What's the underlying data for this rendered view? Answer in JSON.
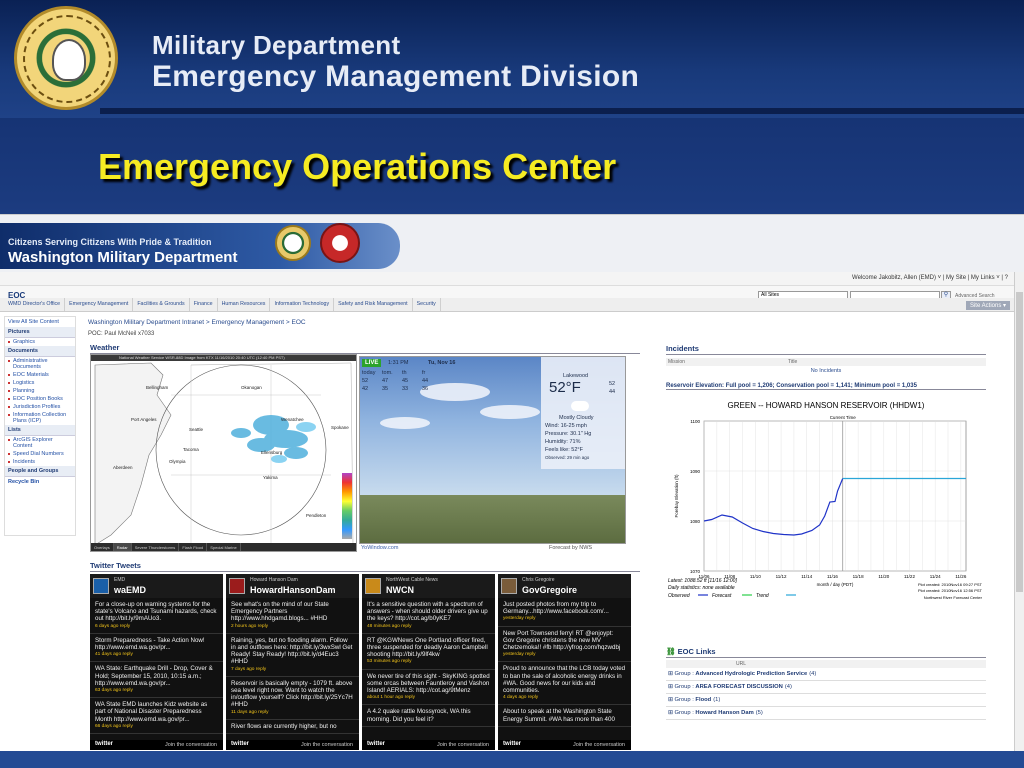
{
  "slide": {
    "header_line1": "Military Department",
    "header_line2": "Emergency Management Division",
    "title": "Emergency Operations Center",
    "title_color": "#f6ec22"
  },
  "site": {
    "tagline": "Citizens Serving Citizens With Pride & Tradition",
    "name": "Washington Military Department",
    "welcome": "Welcome Jakobitz, Allen (EMD) ˅ | My Site | My Links ˅ | ?",
    "title": "EOC",
    "search_scope": "All Sites",
    "advanced_search": "Advanced Search",
    "site_actions": "Site Actions ▾",
    "nav_tabs": [
      "WMD Director's Office",
      "Emergency Management",
      "Facilities & Grounds",
      "Finance",
      "Human Resources",
      "Information Technology",
      "Safety and Risk Management",
      "Security"
    ]
  },
  "leftnav": {
    "view_all": "View All Site Content",
    "sections": [
      {
        "head": "Pictures",
        "items": [
          "Graphics"
        ]
      },
      {
        "head": "Documents",
        "items": [
          "Administrative Documents",
          "EOC Materials",
          "Logistics",
          "Planning",
          "EOC Position Books",
          "Jurisdiction Profiles",
          "Information Collection Plans (ICP)"
        ]
      },
      {
        "head": "Lists",
        "items": [
          "ArcGIS Explorer Content",
          "Speed Dial Numbers",
          "Incidents"
        ]
      },
      {
        "head": "People and Groups",
        "items": []
      }
    ],
    "recycle": "Recycle Bin"
  },
  "main": {
    "breadcrumb": "Washington Military Department Intranet > Emergency Management > EOC",
    "poc": "POC: Paul McNeil x7033",
    "weather_title": "Weather",
    "map_header": "National Weather Service WSR-88D Image from  KTX 11/16/2010 20:40 UTC (12:40 PM PST)",
    "map_tabs": [
      "Overlays",
      "Radar",
      "Severe Thunderstorms",
      "Flash Flood",
      "Special Marine"
    ],
    "map_cities": [
      "Bellingham",
      "Port Angeles",
      "Seattle",
      "Tacoma",
      "Olympia",
      "Aberdeen",
      "Wenatchee",
      "Yakima",
      "Spokane",
      "Pendleton",
      "Ellensburg",
      "Okanogan"
    ],
    "yowindow": {
      "live": "LIVE",
      "time": "1:31 PM",
      "date": "Tu, Nov 16",
      "days": [
        "today",
        "tom.",
        "th",
        "fr"
      ],
      "highs": [
        "52",
        "47",
        "45",
        "44"
      ],
      "lows": [
        "42",
        "35",
        "33",
        "36"
      ],
      "location": "Lakewood",
      "temp": "52°F",
      "hi_lo": [
        "52",
        "44"
      ],
      "condition": "Mostly Cloudy",
      "wind": "Wind:  16-25 mph",
      "pressure": "Pressure:  30.1\" Hg",
      "humidity": "Humidity:  71%",
      "feels": "Feels like:  52°F",
      "observed": "Observed:    29 min ago",
      "footer_left": "YoWindow.com",
      "footer_right": "Forecast by NWS"
    },
    "tweets_title": "Twitter Tweets",
    "tweet_columns": [
      {
        "by": "EMD",
        "handle": "waEMD",
        "avatar_color": "#1a5fa8",
        "tweets": [
          {
            "text": "For a close-up on warning systems for the state's Volcano and Tsunami hazards, check out http://bit.ly/9mAUo3.",
            "ago": "6 days ago reply"
          },
          {
            "text": "Storm Preparedness - Take Action Now! http://www.emd.wa.gov/pr...",
            "ago": "41 days ago reply"
          },
          {
            "text": "WA State: Earthquake Drill - Drop, Cover & Hold; September 15, 2010, 10:15 a.m.; http://www.emd.wa.gov/pr...",
            "ago": "63 days ago reply"
          },
          {
            "text": "WA State EMD launches Kidz website as part of National Disaster Preparedness Month http://www.emd.wa.gov/pr...",
            "ago": "66 days ago reply"
          }
        ]
      },
      {
        "by": "Howard Hanson Dam",
        "handle": "HowardHansonDam",
        "avatar_color": "#9b1c1c",
        "tweets": [
          {
            "text": "See what's on the mind of our State Emergency Partners http://www.hhdgamd.blogs... #HHD",
            "ago": "2 hours ago reply"
          },
          {
            "text": "Raining, yes, but no flooding alarm. Follow in and outflows here: http://bit.ly/3wxSwl Get Ready! Stay Ready! http://bit.ly/d4Euc3 #HHD",
            "ago": "7 days ago reply"
          },
          {
            "text": "Reservoir is basically empty - 1079 ft. above sea level right now. Want to watch the in/outflow yourself? Click http://bit.ly/25Yc7H #HHD",
            "ago": "11 days ago reply"
          },
          {
            "text": "River flows are currently higher, but no",
            "ago": ""
          }
        ]
      },
      {
        "by": "NorthWest Cable News",
        "handle": "NWCN",
        "avatar_color": "#c98a1a",
        "tweets": [
          {
            "text": "It's a sensitive question with a spectrum of answers - when should older drivers give up the keys? http://cot.ag/b0yKE7",
            "ago": "48 minutes ago reply"
          },
          {
            "text": "RT @KGWNews One Portland officer fired, three suspended for deadly Aaron Campbell shooting http://bit.ly/9lf4kw",
            "ago": "53 minutes ago reply"
          },
          {
            "text": "We never tire of this sight - SkyKING spotted some orcas between Fauntleroy and Vashon Island! AERIALS: http://cot.ag/9tMenz",
            "ago": "about 1 hour ago reply"
          },
          {
            "text": "A 4.2 quake rattle Mossyrock, WA this morning. Did you feel it?",
            "ago": ""
          }
        ]
      },
      {
        "by": "Chris Gregoire",
        "handle": "GovGregoire",
        "avatar_color": "#7a5c3a",
        "tweets": [
          {
            "text": "Just posted photos from my trip to Germany...http://www.facebook.com/...",
            "ago": "yesterday reply"
          },
          {
            "text": "New Port Townsend ferry! RT @enjoypt: Gov Gregoire christens the new MV Chetzemoka!! #fb http://yfrog.com/hqzwdbj",
            "ago": "yesterday reply"
          },
          {
            "text": "Proud to announce that the LCB today voted to ban the sale of alcoholic energy drinks in #WA. Good news for our kids and communities.",
            "ago": "4 days ago reply"
          },
          {
            "text": "About to speak at the Washington State Energy Summit. #WA has more than 400",
            "ago": ""
          }
        ]
      }
    ],
    "twitter_label": "twitter",
    "join": "Join the conversation"
  },
  "incidents": {
    "title": "Incidents",
    "col_mission": "Mission",
    "col_title": "Title",
    "empty": "No Incidents"
  },
  "reservoir": {
    "title": "Reservoir Elevation: Full pool = 1,206; Conservation pool = 1,141; Minimum pool = 1,035",
    "note_latest": "Latest:  1088.52 ft [11/16 12:00]",
    "note_daily": "Daily statistics: none available",
    "legend": [
      "Observed",
      "Forecast",
      "Trend"
    ],
    "plot_created": "Plot created:  2010Nov16 09:27 PST",
    "plot_created2": "Plot created:  2010Nov16 12:56 PST",
    "center": "Northwest River Forecast Center"
  },
  "chart_data": {
    "type": "line",
    "title": "GREEN -- HOWARD HANSON RESERVOIR  (HHDW1)",
    "xlabel": "month / day (PDT)",
    "ylabel": "Forebay Elevation  (ft)",
    "annotation": "Current Time",
    "categories": [
      "11/06",
      "11/08",
      "11/10",
      "11/12",
      "11/14",
      "11/16",
      "11/18",
      "11/20",
      "11/22",
      "11/24",
      "11/26"
    ],
    "ylim": [
      1070,
      1100
    ],
    "yticks": [
      "1100",
      "1090",
      "1080",
      "1070"
    ],
    "current_time_x": 10.8,
    "series": [
      {
        "name": "Observed",
        "color": "#1f33c8",
        "points": [
          [
            0,
            1080
          ],
          [
            0.6,
            1080.3
          ],
          [
            1.4,
            1081.2
          ],
          [
            2.2,
            1080.8
          ],
          [
            3.0,
            1079.6
          ],
          [
            3.8,
            1078.5
          ],
          [
            4.6,
            1077.9
          ],
          [
            5.4,
            1077.5
          ],
          [
            6.2,
            1077.3
          ],
          [
            7.0,
            1077.2
          ],
          [
            7.6,
            1077.4
          ],
          [
            8.4,
            1078.1
          ],
          [
            9.0,
            1079.2
          ],
          [
            9.4,
            1081.0
          ],
          [
            9.8,
            1083.8
          ],
          [
            10.2,
            1083.9
          ],
          [
            10.4,
            1086.0
          ],
          [
            10.8,
            1088.5
          ]
        ]
      },
      {
        "name": "Forecast",
        "color": "#2aa6d8",
        "points": [
          [
            10.8,
            1088.5
          ],
          [
            11.0,
            1088.5
          ],
          [
            20.4,
            1088.5
          ]
        ]
      }
    ]
  },
  "eoc_links": {
    "title": "EOC Links",
    "col_url": "URL",
    "groups": [
      {
        "label": "Group : ",
        "name": "Advanced Hydrologic Prediction Service",
        "count": "(4)"
      },
      {
        "label": "Group : ",
        "name": "AREA FORECAST DISCUSSION",
        "count": "(4)"
      },
      {
        "label": "Group : ",
        "name": "Flood",
        "count": "(1)"
      },
      {
        "label": "Group : ",
        "name": "Howard Hanson Dam",
        "count": "(5)"
      }
    ]
  }
}
